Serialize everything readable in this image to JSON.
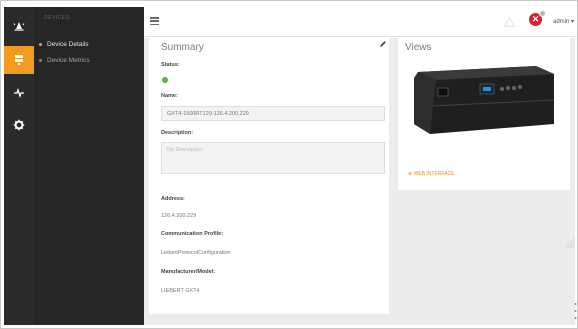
{
  "sidebar": {
    "rail": [
      {
        "icon": "alarm-bell-icon",
        "active": false
      },
      {
        "icon": "devices-icon",
        "active": true
      },
      {
        "icon": "pulse-icon",
        "active": false
      },
      {
        "icon": "gear-icon",
        "active": false
      }
    ],
    "section_title": "DEVICES",
    "items": [
      {
        "label": "Device Details",
        "active": true
      },
      {
        "label": "Device Metrics",
        "active": false
      }
    ]
  },
  "header": {
    "menu_icon": "hamburger-icon",
    "alarm_badge": "✕",
    "user_label": "admin ▾"
  },
  "summary": {
    "title": "Summary",
    "status_label": "Status:",
    "name_label": "Name:",
    "name_value": "GXT4-1500RT120-126.4.200.229",
    "description_label": "Description:",
    "description_placeholder": "No Description",
    "address_label": "Address:",
    "address_value": "126.4.200.229",
    "comm_profile_label": "Communication Profile:",
    "comm_profile_value": "LiebertProtocolConfiguration",
    "manufacturer_label": "Manufacturer/Model:",
    "manufacturer_value": "LIEBERT GXT4"
  },
  "views": {
    "title": "Views",
    "web_interface_label": "⊕ WEB INTERFACE"
  },
  "colors": {
    "accent": "#f39a21",
    "rail_bg": "#2b2b2b",
    "subnav_bg": "#262626",
    "alarm": "#d6202e",
    "status_ok": "#5cb046",
    "content_bg": "#ececec"
  }
}
